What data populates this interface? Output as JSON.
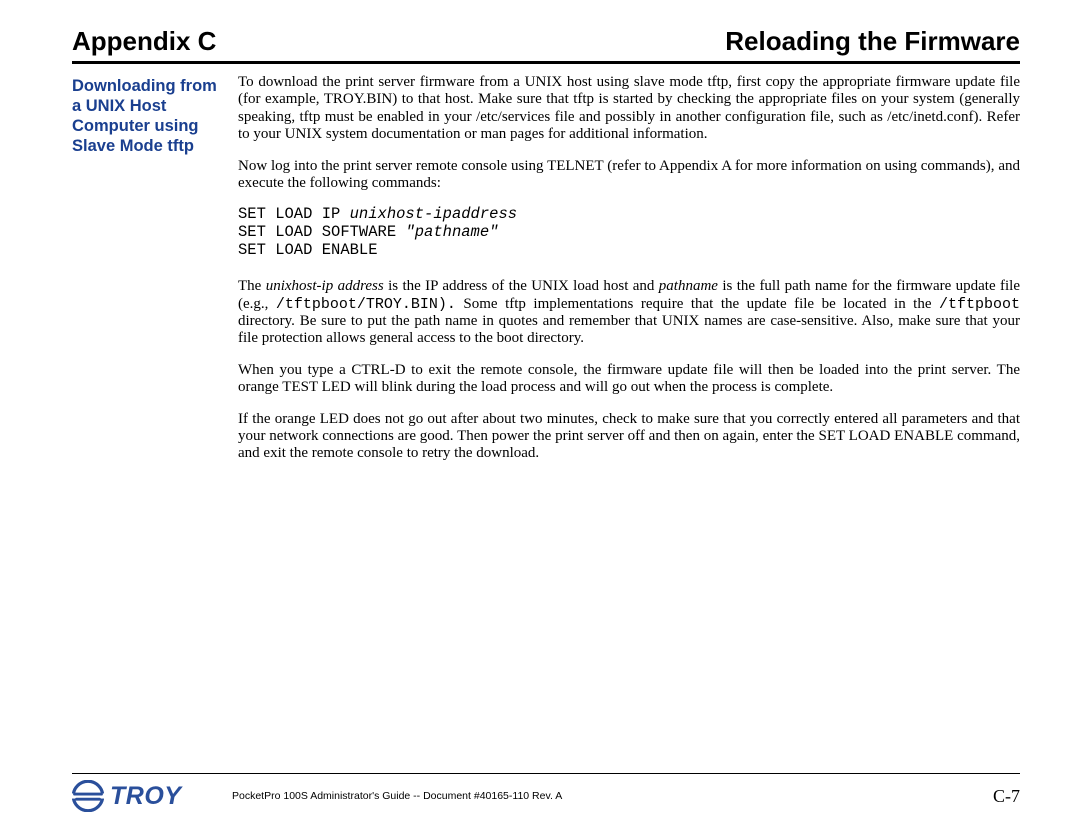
{
  "header": {
    "left": "Appendix C",
    "right": "Reloading the Firmware"
  },
  "sidebar": {
    "heading": "Downloading from a UNIX Host Computer using Slave Mode tftp"
  },
  "main": {
    "p1": "To download the print server firmware from a UNIX host using slave mode tftp, first copy the appropriate firmware update file (for example, TROY.BIN) to that host.  Make sure that tftp is started by checking the appropriate files on your system (generally speaking, tftp must be enabled in your /etc/services file and possibly in another configuration file, such as /etc/inetd.conf).  Refer to your UNIX system documentation or man pages for additional information.",
    "p2": "Now log into the print server remote console using TELNET (refer to Appendix A for more information on using commands), and execute the following commands:",
    "cmd": {
      "l1a": "SET LOAD IP ",
      "l1b": "unixhost-ipaddress",
      "l2a": "SET LOAD SOFTWARE ",
      "l2b": "\"pathname\"",
      "l3": "SET LOAD ENABLE"
    },
    "p3": {
      "a": "The ",
      "b": "unixhost-ip address",
      "c": " is the IP address of the UNIX load host and ",
      "d": "pathname",
      "e": " is the full path name for the firmware update file (e.g., ",
      "f": "/tftpboot/TROY.BIN).",
      "g": "  Some tftp implementations require that the update file be located in the ",
      "h": "/tftpboot",
      "i": " directory.  Be sure to put the path name in quotes and remember that UNIX names are case-sensitive. Also, make sure that your file protection allows general access to the boot directory."
    },
    "p4": "When you type a CTRL-D to exit the remote console, the firmware update file will then be loaded into the print server.  The orange TEST LED will blink during the load process and will go out when the process is complete.",
    "p5": "If the orange LED does not go out after about two minutes, check to make sure that you correctly entered all parameters and that your network connections are good.  Then power the print server off and then on again, enter the SET LOAD ENABLE command, and exit the remote console to retry the download."
  },
  "footer": {
    "logo_text": "TROY",
    "doc": "PocketPro 100S Administrator's Guide -- Document #40165-110  Rev. A",
    "page": "C-7"
  },
  "colors": {
    "sidebar_blue": "#1a3f8f",
    "logo_blue": "#2a4f9b"
  }
}
